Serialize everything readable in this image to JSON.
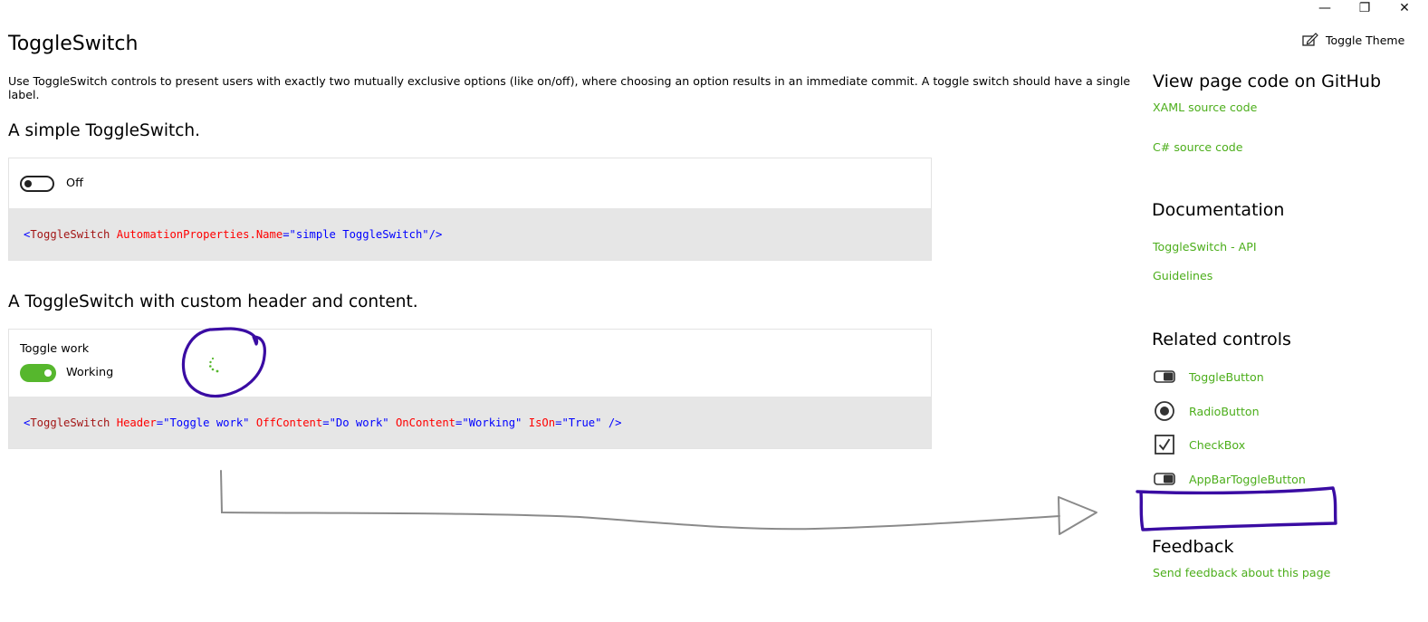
{
  "window": {
    "minimize_glyph": "—",
    "restore_glyph": "❐",
    "close_glyph": "✕"
  },
  "header": {
    "title": "ToggleSwitch",
    "toggle_theme_label": "Toggle Theme",
    "toggle_theme_icon": "edit-theme-icon",
    "description": "Use ToggleSwitch controls to present users with exactly two mutually exclusive options (like on/off), where choosing an option results in an immediate commit. A toggle switch should have a single label."
  },
  "samples": [
    {
      "title": "A simple ToggleSwitch.",
      "toggle_state": "off",
      "toggle_label": "Off",
      "code": {
        "open": "<",
        "tag": "ToggleSwitch",
        "attr1": "AutomationProperties.Name",
        "eq": "=",
        "val1": "\"simple ToggleSwitch\"",
        "close": "/>"
      }
    },
    {
      "title": "A ToggleSwitch with custom header and content.",
      "header": "Toggle work",
      "toggle_state": "on",
      "toggle_label": "Working",
      "code": {
        "open": "<",
        "tag": "ToggleSwitch",
        "attr1": "Header",
        "val1": "\"Toggle work\"",
        "attr2": "OffContent",
        "val2": "\"Do work\"",
        "attr3": "OnContent",
        "val3": "\"Working\"",
        "attr4": "IsOn",
        "val4": "\"True\"",
        "eq": "=",
        "close": "/>"
      }
    }
  ],
  "rail": {
    "github_heading": "View page code on GitHub",
    "xaml_link": "XAML source code",
    "csharp_link": "C# source code",
    "docs_heading": "Documentation",
    "api_link": "ToggleSwitch - API",
    "guidelines_link": "Guidelines",
    "related_heading": "Related controls",
    "related": [
      {
        "label": "ToggleButton",
        "icon": "toggle-button-icon"
      },
      {
        "label": "RadioButton",
        "icon": "radio-button-icon"
      },
      {
        "label": "CheckBox",
        "icon": "checkbox-icon"
      },
      {
        "label": "AppBarToggleButton",
        "icon": "appbar-toggle-icon"
      }
    ],
    "feedback_heading": "Feedback",
    "feedback_link": "Send feedback about this page"
  },
  "colors": {
    "accent": "#4cae1b",
    "annotation": "#3a0ca3",
    "code_bg": "#e6e6e6",
    "arrow": "#8a8a8a"
  }
}
